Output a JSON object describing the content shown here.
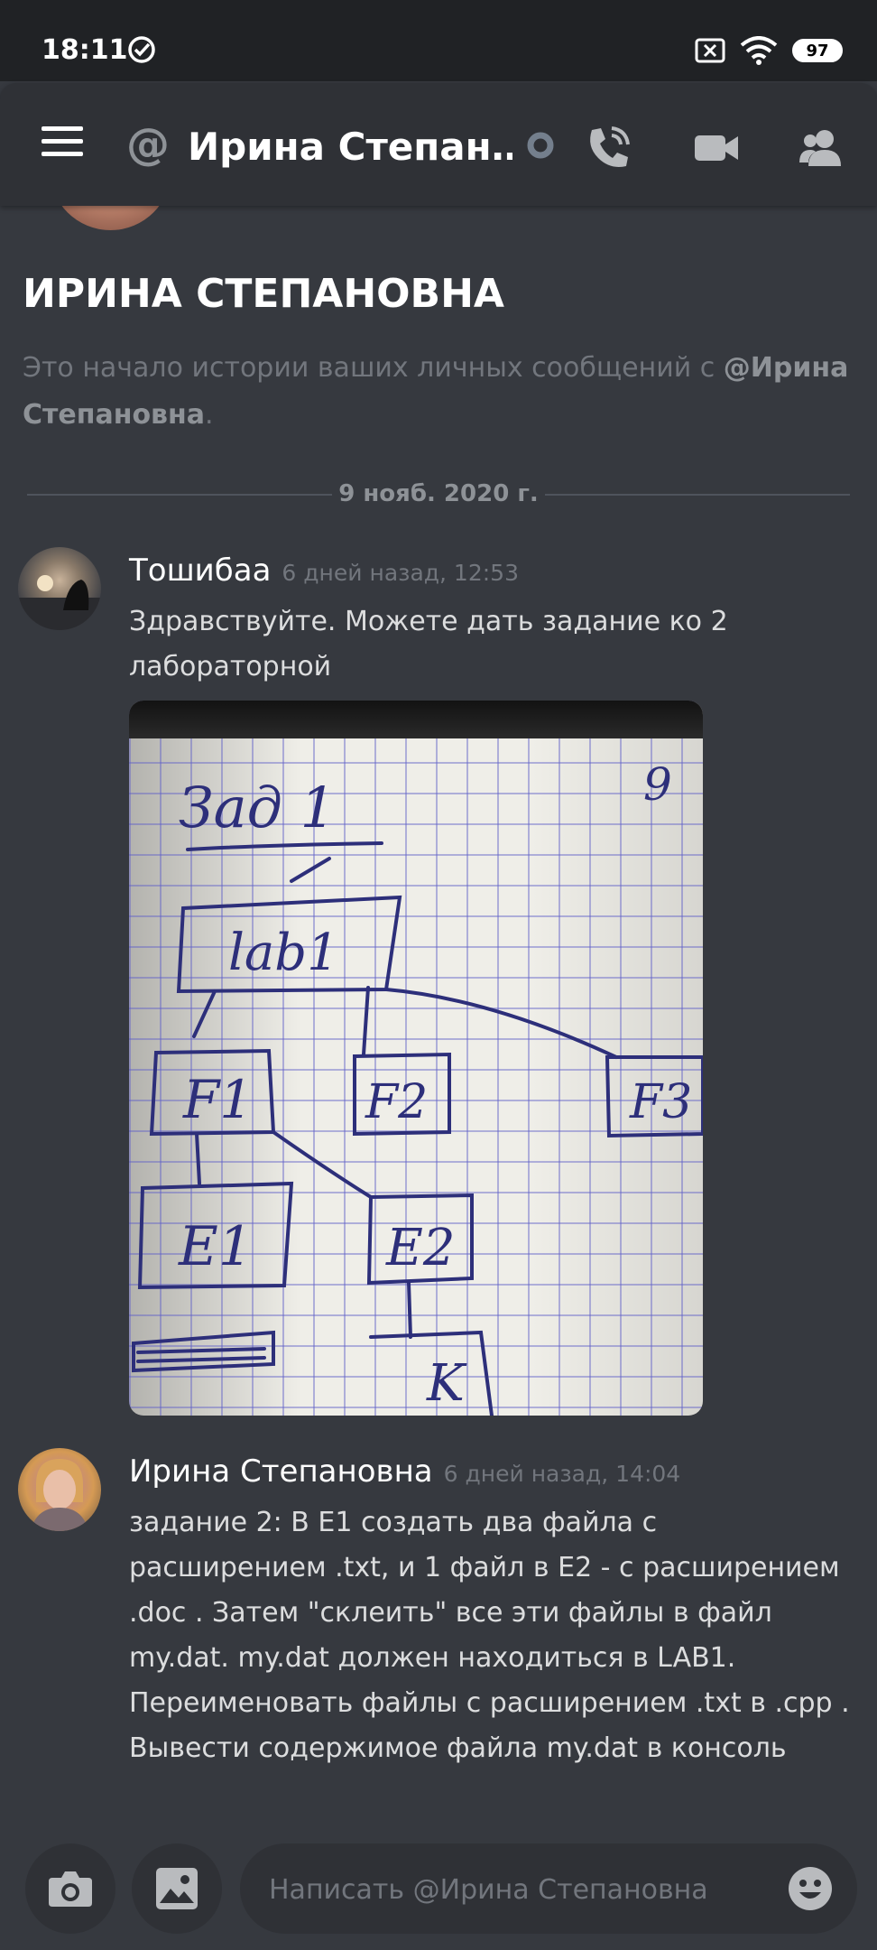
{
  "status_bar": {
    "time": "18:11",
    "battery": "97"
  },
  "header": {
    "title": "Ирина Степан…"
  },
  "intro": {
    "title": "ИРИНА СТЕПАНОВНА",
    "subtitle_prefix": "Это начало истории ваших личных сообщений с ",
    "subtitle_mention": "@Ирина Степановна",
    "subtitle_suffix": "."
  },
  "divider": {
    "date": "9 нояб. 2020 г."
  },
  "messages": [
    {
      "author": "Тошибаа",
      "timestamp": "6 дней назад, 12:53",
      "text": "Здравствуйте. Можете дать задание ко 2 лабораторной",
      "attachment": {
        "heading": "Зад 1",
        "corner": "9",
        "nodes": [
          "lab1",
          "F1",
          "F2",
          "F3",
          "E1",
          "E2",
          "K"
        ]
      }
    },
    {
      "author": "Ирина Степановна",
      "timestamp": "6 дней назад, 14:04",
      "text": "задание 2: В E1 создать два файла с расширением .txt, и 1 файл в E2 - с расширением .doc . Затем \"склеить\" все эти файлы в файл my.dat. my.dat должен находиться в LAB1. Переименовать файлы с расширением .txt в .cpp . Вывести содержимое файла my.dat в консоль"
    }
  ],
  "composer": {
    "placeholder": "Написать @Ирина Степановна"
  }
}
